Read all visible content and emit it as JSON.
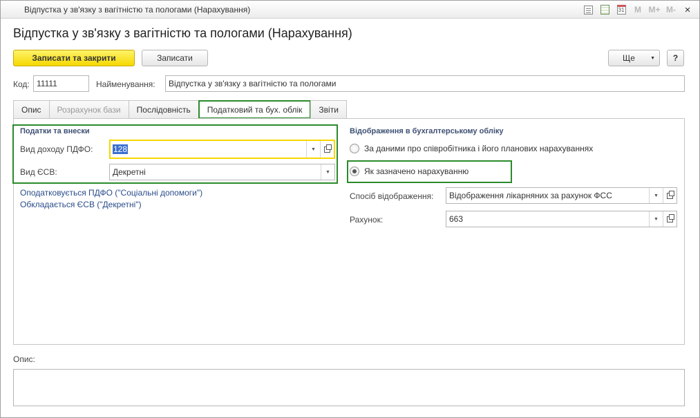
{
  "window": {
    "title": "Відпустка у зв'язку з вагітністю та пологами (Нарахування)",
    "toolbar_icons": [
      "document-icon",
      "spreadsheet-icon",
      "calendar-icon"
    ],
    "calendar_day": "31",
    "memory_buttons": [
      "M",
      "M+",
      "M-"
    ],
    "close_label": "×"
  },
  "header": {
    "heading": "Відпустка у зв'язку з вагітністю та пологами (Нарахування)"
  },
  "actions": {
    "save_close_label": "Записати та закрити",
    "save_label": "Записати",
    "more_label": "Ще",
    "more_arrow": "▼",
    "help_label": "?"
  },
  "fields": {
    "code_label": "Код:",
    "code_value": "11111",
    "name_label": "Найменування:",
    "name_value": "Відпустка у зв'язку з вагітністю та пологами"
  },
  "tabs": [
    {
      "label": "Опис",
      "state": "normal"
    },
    {
      "label": "Розрахунок бази",
      "state": "disabled"
    },
    {
      "label": "Послідовність",
      "state": "normal"
    },
    {
      "label": "Податковий та бух. облік",
      "state": "active"
    },
    {
      "label": "Звіти",
      "state": "normal"
    }
  ],
  "taxes": {
    "section_title": "Податки та внески",
    "pdfo_label": "Вид доходу ПДФО:",
    "pdfo_value": "128",
    "esv_label": "Вид ЄСВ:",
    "esv_value": "Декретні",
    "link_pdfo": "Оподатковується ПДФО (\"Соціальні допомоги\")",
    "link_esv": "Обкладається ЄСВ (\"Декретні\")"
  },
  "accounting": {
    "section_title": "Відображення в бухгалтерському обліку",
    "radio_employee_label": "За даними про співробітника і його планових нарахуваннях",
    "radio_accrual_label": "Як зазначено нарахуванню",
    "selected_option": "Як зазначено нарахуванню",
    "method_label": "Спосіб відображення:",
    "method_value": "Відображення лікарняних за рахунок ФСС",
    "account_label": "Рахунок:",
    "account_value": "663"
  },
  "description": {
    "label": "Опис:",
    "value": ""
  },
  "colors": {
    "highlight_frame": "#2a8a2a",
    "primary_button": "#f5d800",
    "link": "#2a4c8a",
    "section_title": "#3d4f73",
    "selection": "#3a6fd0"
  }
}
